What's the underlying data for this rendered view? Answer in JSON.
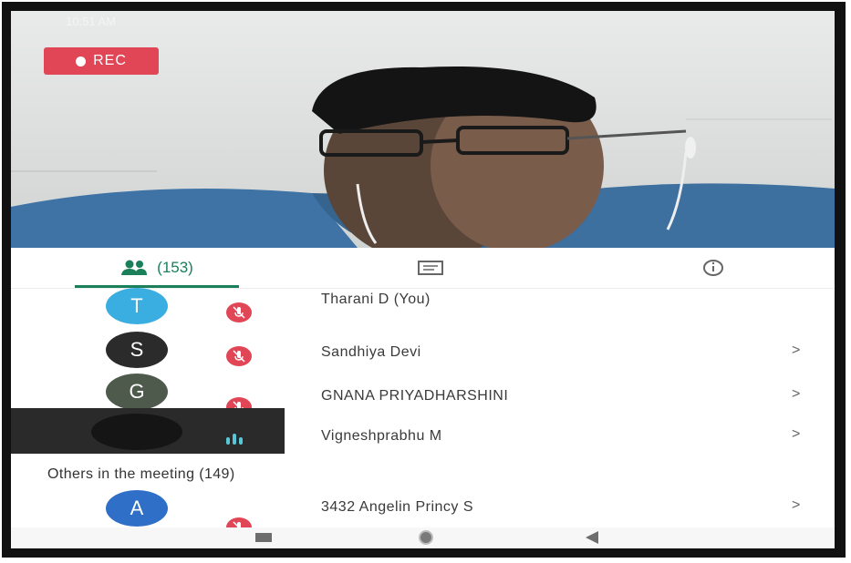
{
  "status_bar": {
    "time": "10:51 AM",
    "right": ""
  },
  "recording": {
    "label": "REC",
    "color": "#e14656"
  },
  "tabs": {
    "people": {
      "count_label": "(153)",
      "icon": "people-icon",
      "active": true
    },
    "chat": {
      "icon": "chat-icon"
    },
    "info": {
      "icon": "info-icon"
    }
  },
  "participants": [
    {
      "initial": "T",
      "name": "Tharani D (You)",
      "avatar_color": "#3aaee0",
      "muted": true,
      "chevron": ""
    },
    {
      "initial": "S",
      "name": "Sandhiya Devi",
      "avatar_color": "#2b2b2b",
      "muted": true,
      "chevron": ">"
    },
    {
      "initial": "G",
      "name": "GNANA PRIYADHARSHINI",
      "avatar_color": "#4e5a4c",
      "muted": true,
      "chevron": ">"
    },
    {
      "initial": "",
      "name": "Vigneshprabhu M",
      "avatar_color": "#151515",
      "muted": false,
      "chevron": ">"
    }
  ],
  "others": {
    "heading": "Others in the meeting (149)",
    "items": [
      {
        "initial": "A",
        "name": "3432 Angelin Princy S",
        "avatar_color": "#2f6fc7",
        "muted": true,
        "chevron": ">"
      }
    ]
  },
  "colors": {
    "accent": "#1b7f5a",
    "mute": "#e14656"
  }
}
